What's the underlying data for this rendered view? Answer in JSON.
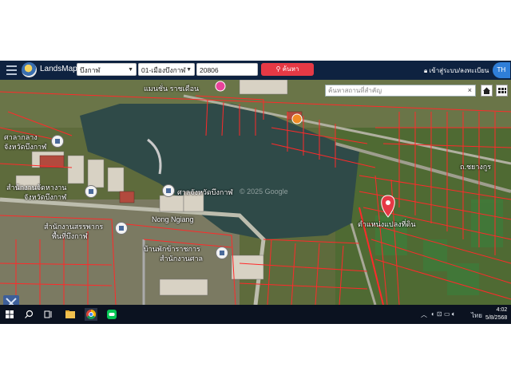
{
  "header": {
    "brand": "LandsMaps",
    "province_select": "บึงกาฬ",
    "district_select": "01-เมืองบึงกาฬ",
    "parcel_input": "20806",
    "search_button": "ค้นหา",
    "login_link": "เข้าสู่ระบบ/ลงทะเบียน",
    "lang_button": "TH"
  },
  "map": {
    "search_placeholder": "ค้นหาสถานที่สำคัญ",
    "search_clear": "×",
    "labels": {
      "top_village": "แมนชั่น ราชเดือน",
      "court": "ศาลากลาง",
      "court_sub": "จังหวัดบึงกาฬ",
      "office": "สำนักงานจัดหางาน",
      "office_sub": "จังหวัดบึงกาฬ",
      "provincial_court": "ศาลจังหวัดบึงกาฬ",
      "nong_ngiang": "Nong Ngiang",
      "revenue": "สำนักงานสรรพากร",
      "revenue_sub": "พื้นที่บึงกาฬ",
      "housing": "บ้านพักข้าราชการ",
      "housing_sub": "สำนักงานศาล",
      "pin_label": "ตำแหน่งแปลงที่ดิน",
      "road_right": "ถ.ชยางกูร",
      "watermark": "© 2025 Google"
    }
  },
  "taskbar": {
    "time": "4:02",
    "date": "5/8/2568",
    "lang": "ไทย"
  },
  "colors": {
    "navbar": "#0e2240",
    "search_btn": "#e53945",
    "parcel_lines": "#ff2a2a",
    "water": "#2f4f4f"
  }
}
